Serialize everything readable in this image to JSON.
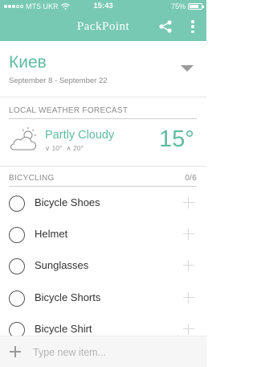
{
  "status_bar": {
    "carrier": "MTS UKR",
    "time": "15:43",
    "battery_percent": "75%",
    "battery_level": 0.75
  },
  "nav": {
    "title": "PackPoint",
    "share_icon": "share-icon",
    "more_icon": "more-vertical-icon"
  },
  "trip": {
    "city": "Киев",
    "dates": "September 8 - September 22"
  },
  "weather": {
    "section_title": "LOCAL WEATHER FORECAST",
    "condition": "Partly Cloudy",
    "low": "∨ 10°",
    "high": "∧ 20°",
    "temperature": "15°",
    "icon": "partly-cloudy-icon"
  },
  "bicycling": {
    "section_title": "BICYCLING",
    "count": "0/6",
    "items": [
      {
        "label": "Bicycle Shoes"
      },
      {
        "label": "Helmet"
      },
      {
        "label": "Sunglasses"
      },
      {
        "label": "Bicycle Shorts"
      },
      {
        "label": "Bicycle Shirt"
      }
    ]
  },
  "new_item": {
    "placeholder": "Type new item..."
  },
  "colors": {
    "accent": "#78c9b4",
    "accent_text": "#5fbca1"
  }
}
